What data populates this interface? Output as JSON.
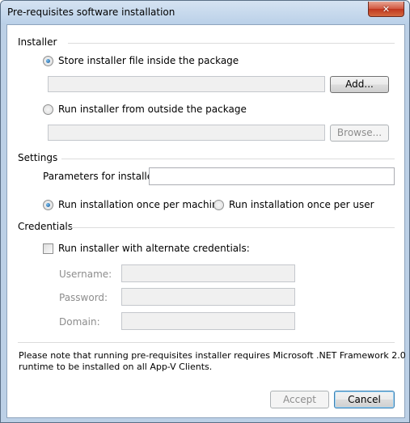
{
  "window": {
    "title": "Pre-requisites software installation",
    "close_icon": "close-icon",
    "close_glyph": "✕"
  },
  "installer": {
    "group_label": "Installer",
    "option_inside_label": "Store installer file inside the package",
    "option_inside_selected": true,
    "inside_path_value": "",
    "add_button_label": "Add...",
    "option_outside_label": "Run installer from outside the package",
    "option_outside_selected": false,
    "outside_path_value": "",
    "browse_button_label": "Browse..."
  },
  "settings": {
    "group_label": "Settings",
    "parameters_label": "Parameters for installer:",
    "parameters_value": "",
    "per_machine_label": "Run installation once per machine",
    "per_machine_selected": true,
    "per_user_label": "Run installation once per user",
    "per_user_selected": false
  },
  "credentials": {
    "group_label": "Credentials",
    "alternate_label": "Run installer with alternate credentials:",
    "alternate_checked": false,
    "username_label": "Username:",
    "username_value": "",
    "password_label": "Password:",
    "password_value": "",
    "domain_label": "Domain:",
    "domain_value": ""
  },
  "note": {
    "line1": "Please note that running pre-requisites installer requires Microsoft .NET Framework 2.0",
    "line2": "runtime to be installed on all App-V Clients."
  },
  "footer": {
    "accept_label": "Accept",
    "cancel_label": "Cancel"
  },
  "colors": {
    "window_frame": "#bcd0e6",
    "close_button": "#c0371f",
    "separator": "#dcdcdc",
    "disabled_text": "#8d8d8d"
  }
}
